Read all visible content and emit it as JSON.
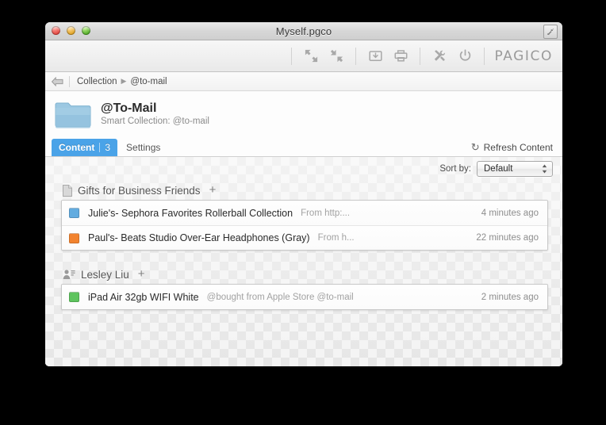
{
  "window": {
    "title": "Myself.pgco",
    "traffic_lights": [
      "close-button",
      "minimize-button",
      "zoom-button"
    ],
    "resize_icon": "resize-icon"
  },
  "toolbar": {
    "buttons": [
      {
        "name": "expand-all-button",
        "icon": "expand-arrows-icon"
      },
      {
        "name": "collapse-all-button",
        "icon": "collapse-arrows-icon"
      },
      {
        "name": "archive-button",
        "icon": "archive-download-icon"
      },
      {
        "name": "print-button",
        "icon": "printer-icon"
      },
      {
        "name": "tools-button",
        "icon": "hammer-wrench-icon"
      },
      {
        "name": "power-button",
        "icon": "power-icon"
      }
    ],
    "brand": "PAGICO"
  },
  "breadcrumb": {
    "back_icon": "back-arrow-icon",
    "root": "Collection",
    "separator": "▶",
    "current": "@to-mail"
  },
  "collection": {
    "icon": "folder-icon",
    "title": "@To-Mail",
    "subtitle": "Smart Collection: @to-mail"
  },
  "tabs": [
    {
      "label": "Content",
      "badge": "3",
      "active": true
    },
    {
      "label": "Settings",
      "badge": "",
      "active": false
    }
  ],
  "refresh": {
    "icon": "↻",
    "label": "Refresh Content"
  },
  "sort": {
    "label": "Sort by:",
    "value": "Default",
    "options": [
      "Default"
    ]
  },
  "groups": [
    {
      "icon": "project-document-icon",
      "title": "Gifts for Business Friends",
      "add_label": "+",
      "items": [
        {
          "color": "#62ace0",
          "title": "Julie's- Sephora Favorites Rollerball Collection",
          "meta": "From http:...",
          "time": "4 minutes ago"
        },
        {
          "color": "#f2832f",
          "title": "Paul's- Beats Studio Over-Ear Headphones (Gray)",
          "meta": "From h...",
          "time": "22 minutes ago"
        }
      ]
    },
    {
      "icon": "contact-person-icon",
      "title": "Lesley Liu",
      "add_label": "+",
      "items": [
        {
          "color": "#5ec45e",
          "title": "iPad Air 32gb WIFI White",
          "meta": "@bought from Apple Store @to-mail",
          "time": "2 minutes ago"
        }
      ]
    }
  ],
  "colors": {
    "accent_blue": "#4aa3e8",
    "item_blue": "#62ace0",
    "item_orange": "#f2832f",
    "item_green": "#5ec45e",
    "folder_blue": "#9bc7e0"
  }
}
